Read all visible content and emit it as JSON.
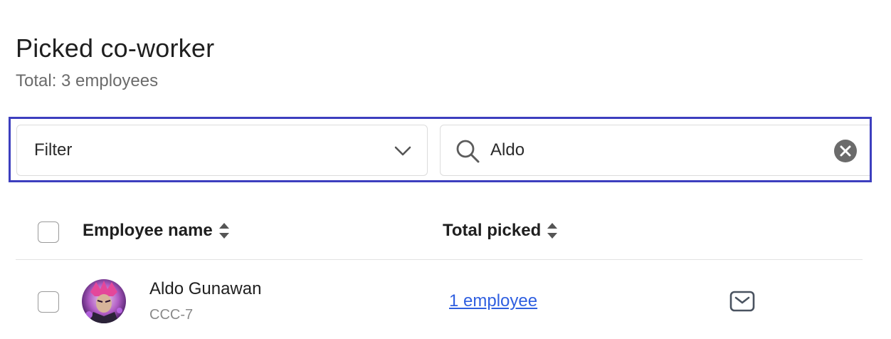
{
  "header": {
    "title": "Picked co-worker",
    "subtitle": "Total: 3 employees"
  },
  "filter": {
    "label": "Filter",
    "icon": "chevron-down-icon"
  },
  "search": {
    "value": "Aldo",
    "icon": "search-icon",
    "clear_icon": "clear-icon"
  },
  "colors": {
    "highlight_border": "#3d3fbf",
    "link": "#2f5fe0"
  },
  "table": {
    "columns": [
      {
        "label": "Employee name",
        "sortable": true
      },
      {
        "label": "Total picked",
        "sortable": true
      }
    ],
    "rows": [
      {
        "name": "Aldo Gunawan",
        "id": "CCC-7",
        "total_picked": "1 employee",
        "action_icon": "mail-icon"
      }
    ]
  }
}
